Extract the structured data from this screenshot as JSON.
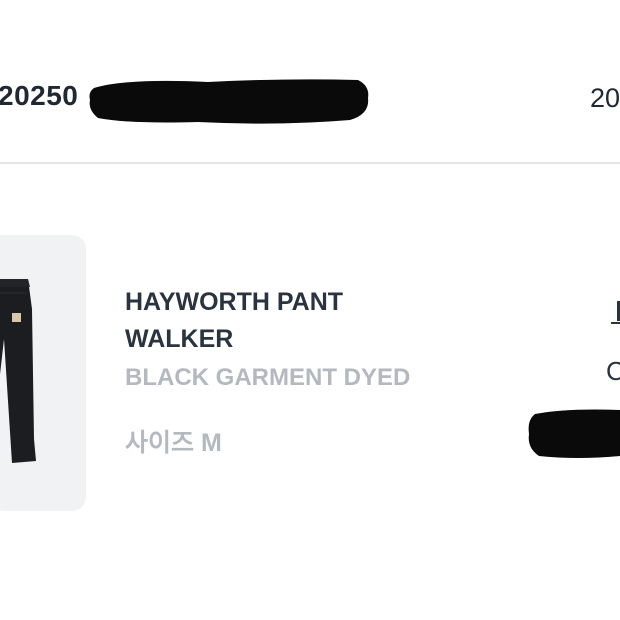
{
  "order": {
    "number_prefix": "20250",
    "date_prefix": "20"
  },
  "product": {
    "name": "HAYWORTH PANT\nWALKER",
    "color": "BLACK GARMENT DYED",
    "size": "사이즈 M",
    "status_prefix": "C",
    "image_icon": "pants-icon"
  },
  "colors": {
    "title_text": "#2a3340",
    "muted_text": "#b4b8bf",
    "divider": "#e3e5e8",
    "thumb_bg": "#f1f2f4",
    "redaction": "#0a0a0a"
  }
}
